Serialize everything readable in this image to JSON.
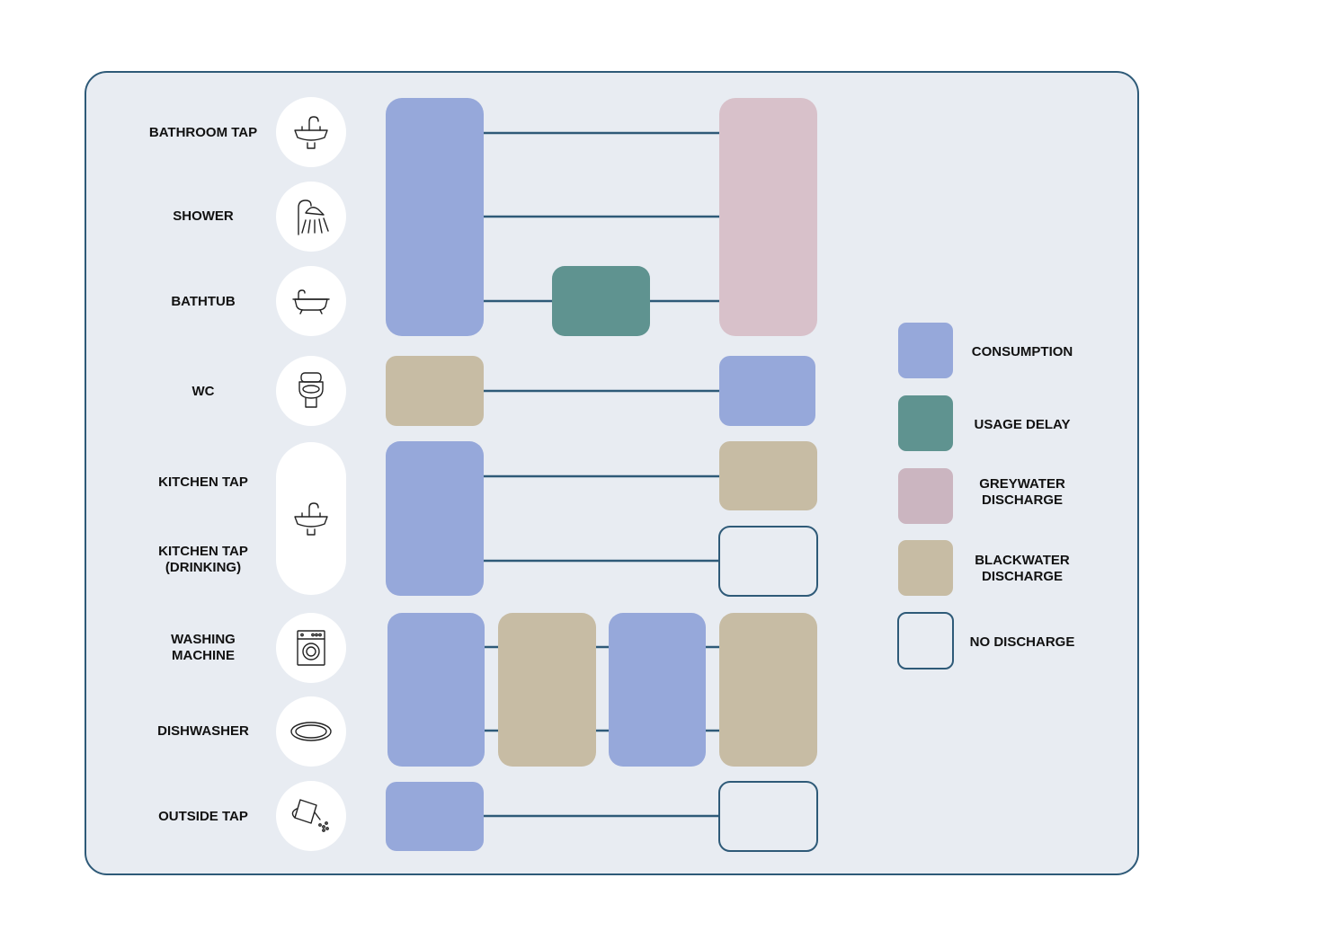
{
  "colors": {
    "panel_bg": "#e8ecf2",
    "panel_border": "#2e5a78",
    "consumption": "#96a8da",
    "usage_delay": "#5f9390",
    "greywater": "#d8c1ca",
    "greywater_legend": "#cbb5c0",
    "blackwater": "#c7bca4",
    "no_discharge_border": "#2e5a78",
    "connector": "#2e5a78",
    "icon_bg": "#ffffff"
  },
  "fixtures": [
    {
      "id": "bathroom-tap",
      "lines": [
        "BATHROOM TAP"
      ],
      "icon": "sink-icon"
    },
    {
      "id": "shower",
      "lines": [
        "SHOWER"
      ],
      "icon": "shower-icon"
    },
    {
      "id": "bathtub",
      "lines": [
        "BATHTUB"
      ],
      "icon": "bathtub-icon"
    },
    {
      "id": "wc",
      "lines": [
        "WC"
      ],
      "icon": "toilet-icon"
    },
    {
      "id": "kitchen-tap",
      "lines": [
        "KITCHEN TAP"
      ],
      "icon": "sink-icon"
    },
    {
      "id": "kitchen-tap-drinking",
      "lines": [
        "KITCHEN TAP",
        "(DRINKING)"
      ],
      "icon": "sink-icon"
    },
    {
      "id": "washing-machine",
      "lines": [
        "WASHING",
        "MACHINE"
      ],
      "icon": "washing-machine-icon"
    },
    {
      "id": "dishwasher",
      "lines": [
        "DISHWASHER"
      ],
      "icon": "plate-icon"
    },
    {
      "id": "outside-tap",
      "lines": [
        "OUTSIDE TAP"
      ],
      "icon": "watering-can-icon"
    }
  ],
  "legend": [
    {
      "key": "consumption",
      "lines": [
        "CONSUMPTION"
      ]
    },
    {
      "key": "usage_delay",
      "lines": [
        "USAGE DELAY"
      ]
    },
    {
      "key": "greywater",
      "lines": [
        "GREYWATER",
        "DISCHARGE"
      ]
    },
    {
      "key": "blackwater",
      "lines": [
        "BLACKWATER",
        "DISCHARGE"
      ]
    },
    {
      "key": "no_discharge",
      "lines": [
        "NO DISCHARGE"
      ]
    }
  ]
}
